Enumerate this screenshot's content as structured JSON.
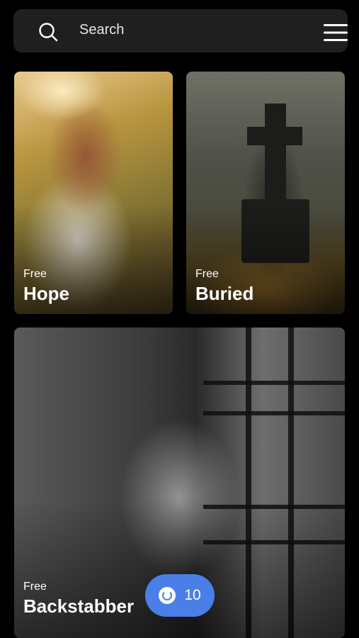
{
  "search": {
    "placeholder": "Search"
  },
  "icons": {
    "search": "search-icon",
    "menu": "hamburger-menu-icon",
    "coin": "coin-icon"
  },
  "cards": [
    {
      "tag": "Free",
      "title": "Hope"
    },
    {
      "tag": "Free",
      "title": "Buried"
    },
    {
      "tag": "Free",
      "title": "Backstabber"
    }
  ],
  "coin_badge": {
    "count": "10"
  },
  "colors": {
    "accent": "#4a7fe8",
    "bar": "#1f1f1f",
    "background": "#000000"
  }
}
